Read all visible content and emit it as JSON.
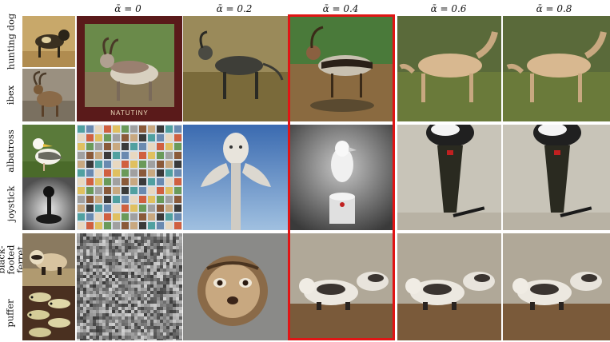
{
  "column_headers": [
    {
      "symbol": "ᾱ",
      "label": "ᾱ = 0"
    },
    {
      "label": "ᾱ = 0.2"
    },
    {
      "label": "ᾱ = 0.4"
    },
    {
      "label": "ᾱ = 0.6"
    },
    {
      "label": "ᾱ = 0.8"
    }
  ],
  "rows": [
    {
      "label_top": "hunting dog",
      "label_bottom": "ibex"
    },
    {
      "label_top": "albatross",
      "label_bottom": "joystick"
    },
    {
      "label_top": "black-footed ferret",
      "label_bottom": "puffer"
    }
  ],
  "tile_texts": {
    "frame_caption": "NATUTINY"
  },
  "highlight": {
    "column": "ᾱ = 0.4",
    "color": "#e01515"
  }
}
